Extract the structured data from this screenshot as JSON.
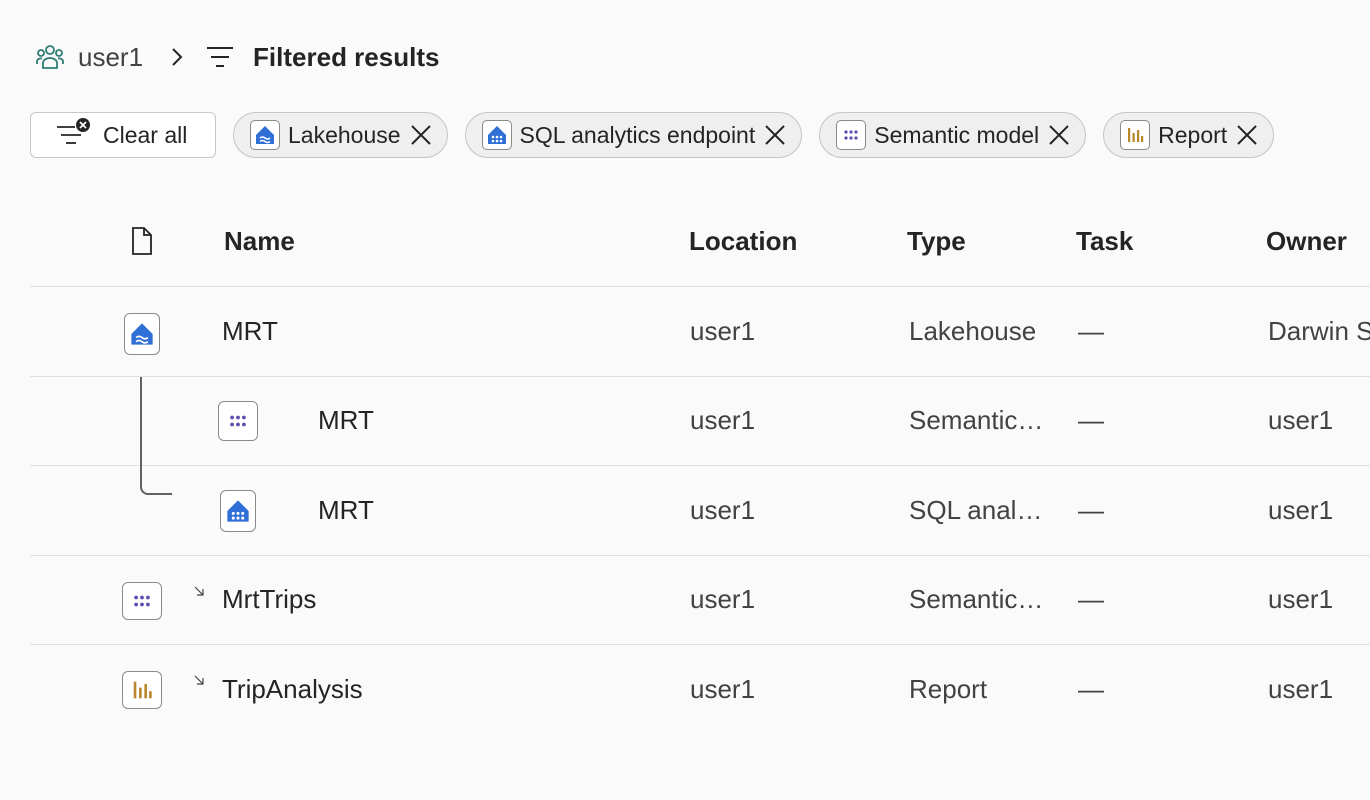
{
  "breadcrumb": {
    "workspace": "user1",
    "title": "Filtered results"
  },
  "filters": {
    "clear_label": "Clear all",
    "chips": [
      {
        "label": "Lakehouse",
        "icon": "lakehouse-icon"
      },
      {
        "label": "SQL analytics endpoint",
        "icon": "sql-endpoint-icon"
      },
      {
        "label": "Semantic model",
        "icon": "semantic-model-icon"
      },
      {
        "label": "Report",
        "icon": "report-icon"
      }
    ]
  },
  "table": {
    "columns": {
      "name": "Name",
      "location": "Location",
      "type": "Type",
      "task": "Task",
      "owner": "Owner"
    },
    "rows": [
      {
        "name": "MRT",
        "location": "user1",
        "type": "Lakehouse",
        "task": "—",
        "owner": "Darwin S",
        "icon": "lakehouse-icon"
      },
      {
        "name": "MRT",
        "location": "user1",
        "type": "Semantic…",
        "task": "—",
        "owner": "user1",
        "icon": "semantic-model-icon"
      },
      {
        "name": "MRT",
        "location": "user1",
        "type": "SQL anal…",
        "task": "—",
        "owner": "user1",
        "icon": "sql-endpoint-icon"
      },
      {
        "name": "MrtTrips",
        "location": "user1",
        "type": "Semantic…",
        "task": "—",
        "owner": "user1",
        "icon": "semantic-model-icon"
      },
      {
        "name": "TripAnalysis",
        "location": "user1",
        "type": "Report",
        "task": "—",
        "owner": "user1",
        "icon": "report-icon"
      }
    ]
  },
  "colors": {
    "lakehouse": "#2f6fd6",
    "semantic": "#5b4fb0",
    "report": "#b8862b"
  }
}
